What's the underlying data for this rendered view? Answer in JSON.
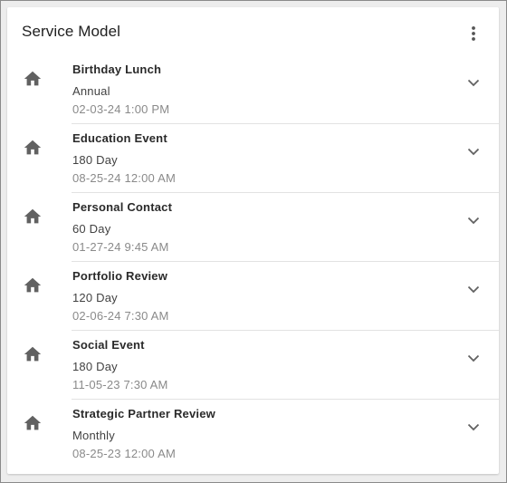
{
  "card": {
    "title": "Service Model",
    "menu_icon": "more-vert-icon"
  },
  "items": [
    {
      "title": "Birthday Lunch",
      "frequency": "Annual",
      "datetime": "02-03-24 1:00 PM",
      "icon": "home-icon"
    },
    {
      "title": "Education Event",
      "frequency": "180 Day",
      "datetime": "08-25-24 12:00 AM",
      "icon": "home-icon"
    },
    {
      "title": "Personal Contact",
      "frequency": "60 Day",
      "datetime": "01-27-24 9:45 AM",
      "icon": "home-icon"
    },
    {
      "title": "Portfolio Review",
      "frequency": "120 Day",
      "datetime": "02-06-24 7:30 AM",
      "icon": "home-icon"
    },
    {
      "title": "Social Event",
      "frequency": "180 Day",
      "datetime": "11-05-23 7:30 AM",
      "icon": "home-icon"
    },
    {
      "title": "Strategic Partner Review",
      "frequency": "Monthly",
      "datetime": "08-25-23 12:00 AM",
      "icon": "home-icon"
    }
  ],
  "colors": {
    "icon": "#616161",
    "title_text": "#2a2a2a",
    "secondary_text": "#8a8a8a",
    "divider": "#e2e2e2"
  }
}
